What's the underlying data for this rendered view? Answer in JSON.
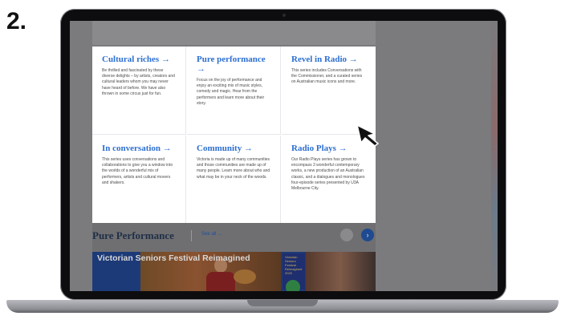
{
  "step_label": "2.",
  "cards": [
    {
      "title": "Cultural riches →",
      "desc": "Be thrilled and fascinated by these diverse delights – by artists, creators and cultural leaders whom you may never have heard of before. We have also thrown in some circus just for fun."
    },
    {
      "title": "Pure performance →",
      "desc": "Focus on the joy of performance and enjoy an exciting mix of music styles, comedy and magic. Hear from the performers and learn more about their story."
    },
    {
      "title": "Revel in Radio →",
      "desc": "This series includes Conversations with the Commissioner, and a curated series on Australian music icons and more."
    },
    {
      "title": "In conversation →",
      "desc": "This series uses conversations and collaborations to give you a window into the worlds of a wonderful mix of performers, artists and cultural movers and shakers."
    },
    {
      "title": "Community →",
      "desc": "Victoria is made up of many communities and those communities are made up of many people. Learn more about who and what may be in your neck of the woods."
    },
    {
      "title": "Radio Plays →",
      "desc": "Our Radio Plays series has grown to encompass 3 wonderful contemporary works, a new production of an Australian classic, and a dialogues and monologues four-episode series presented by U3A Melbourne City."
    }
  ],
  "section": {
    "title": "Pure Performance",
    "see_all": "See all →",
    "next_icon": "›"
  },
  "banner": {
    "text": "Victorian Seniors Festival Reimagined",
    "small_text": "Victorian Seniors Festival Reimagined 2020"
  },
  "colors": {
    "accent": "#2d6fd0",
    "banner_blue": "#1c3a78",
    "overlay": "#7b7b7e"
  }
}
